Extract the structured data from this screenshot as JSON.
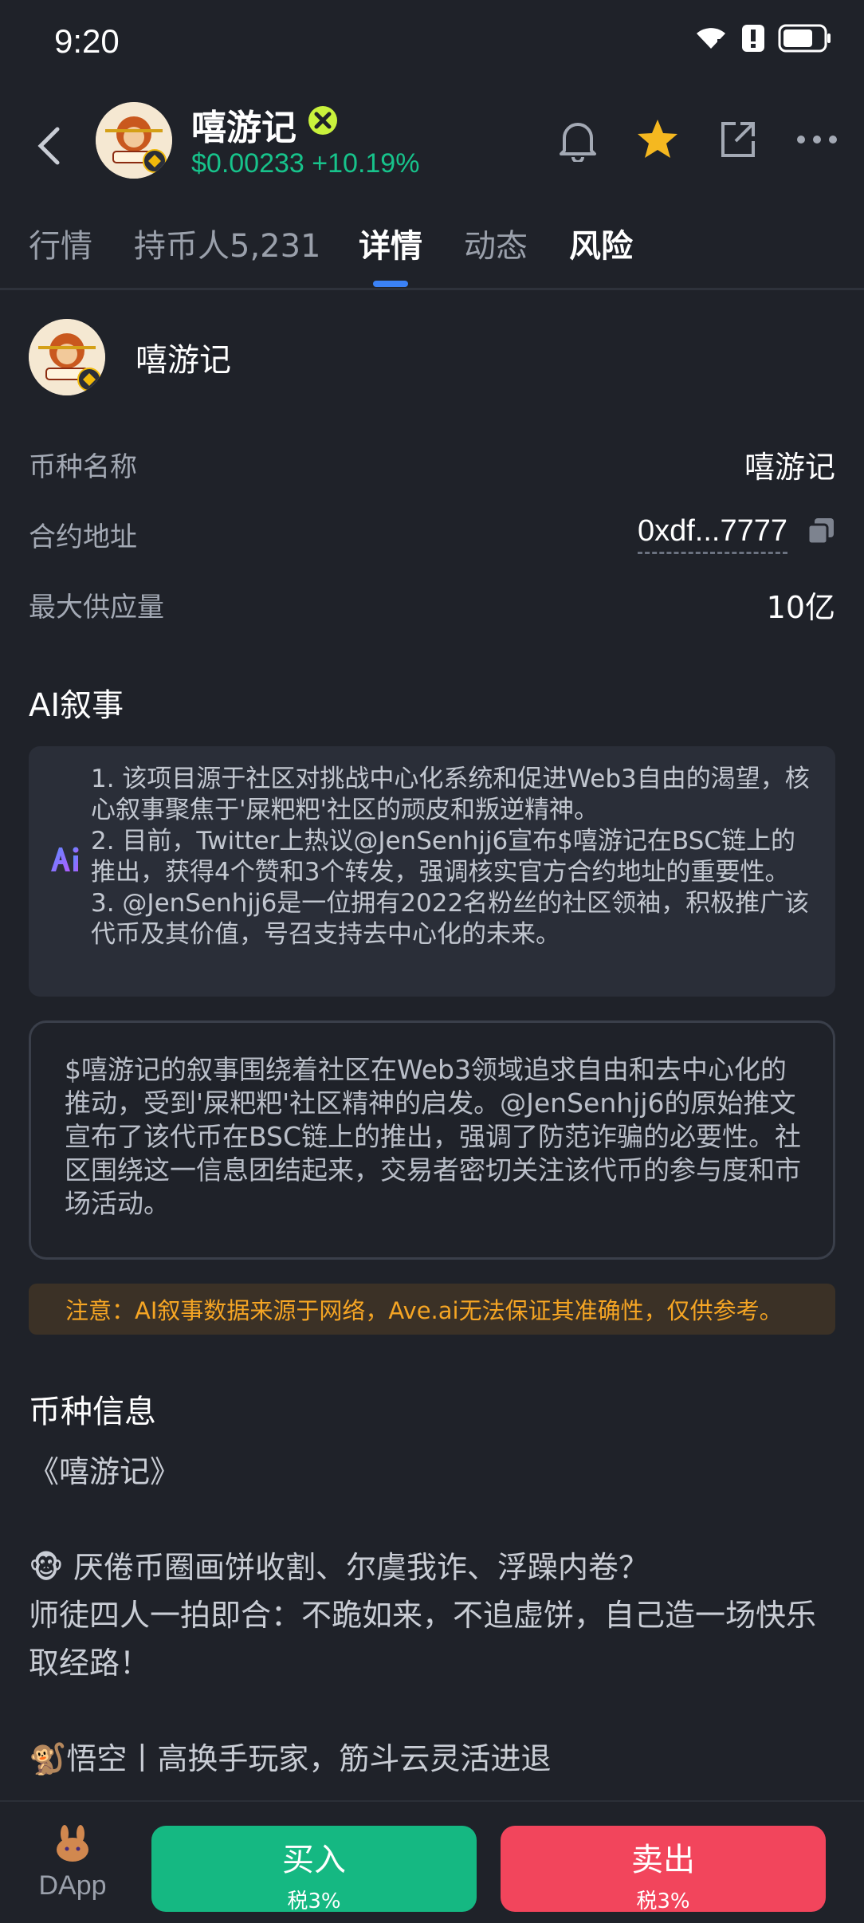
{
  "status_bar": {
    "time": "9:20"
  },
  "header": {
    "token_name": "嘻游记",
    "price": "$0.00233",
    "change": "+10.19%",
    "accent_green": "#17c38b",
    "icons": [
      "back-icon",
      "verified-icon",
      "bell-icon",
      "star-icon",
      "share-icon",
      "more-icon"
    ]
  },
  "tabs": [
    {
      "label": "行情"
    },
    {
      "label": "持币人5,231"
    },
    {
      "label": "详情"
    },
    {
      "label": "动态"
    },
    {
      "label": "风险"
    }
  ],
  "active_tab": "详情",
  "detail": {
    "name": "嘻游记",
    "rows": [
      {
        "label": "币种名称",
        "value": "嘻游记"
      },
      {
        "label": "合约地址",
        "value": "0xdf...7777"
      },
      {
        "label": "最大供应量",
        "value": "10亿"
      }
    ]
  },
  "ai": {
    "title": "AI叙事",
    "points": [
      "1. 该项目源于社区对挑战中心化系统和促进Web3自由的渴望，核心叙事聚焦于'屎粑粑'社区的顽皮和叛逆精神。",
      "2. 目前，Twitter上热议@JenSenhjj6宣布$嘻游记在BSC链上的推出，获得4个赞和3个转发，强调核实官方合约地址的重要性。",
      "3. @JenSenhjj6是一位拥有2022名粉丝的社区领袖，积极推广该代币及其价值，号召支持去中心化的未来。"
    ],
    "summary": "$嘻游记的叙事围绕着社区在Web3领域追求自由和去中心化的推动，受到'屎粑粑'社区精神的启发。@JenSenhjj6的原始推文宣布了该代币在BSC链上的推出，强调了防范诈骗的必要性。社区围绕这一信息团结起来，交易者密切关注该代币的参与度和市场活动。",
    "notice": "注意：AI叙事数据来源于网络，Ave.ai无法保证其准确性，仅供参考。"
  },
  "coin_info": {
    "title": "币种信息",
    "lines": [
      "《嘻游记》",
      "",
      "🐵 厌倦币圈画饼收割、尔虞我诈、浮躁内卷？",
      "师徒四人一拍即合：不跪如来，不追虚饼，自己造一场快乐取经路！",
      "",
      "🐒悟空丨高换手玩家，筋斗云灵活进退"
    ]
  },
  "bottom_bar": {
    "dapp_label": "DApp",
    "buy_label": "买入",
    "buy_tax": "税3%",
    "sell_label": "卖出",
    "sell_tax": "税3%",
    "buy_color": "#15b882",
    "sell_color": "#f2455c"
  }
}
